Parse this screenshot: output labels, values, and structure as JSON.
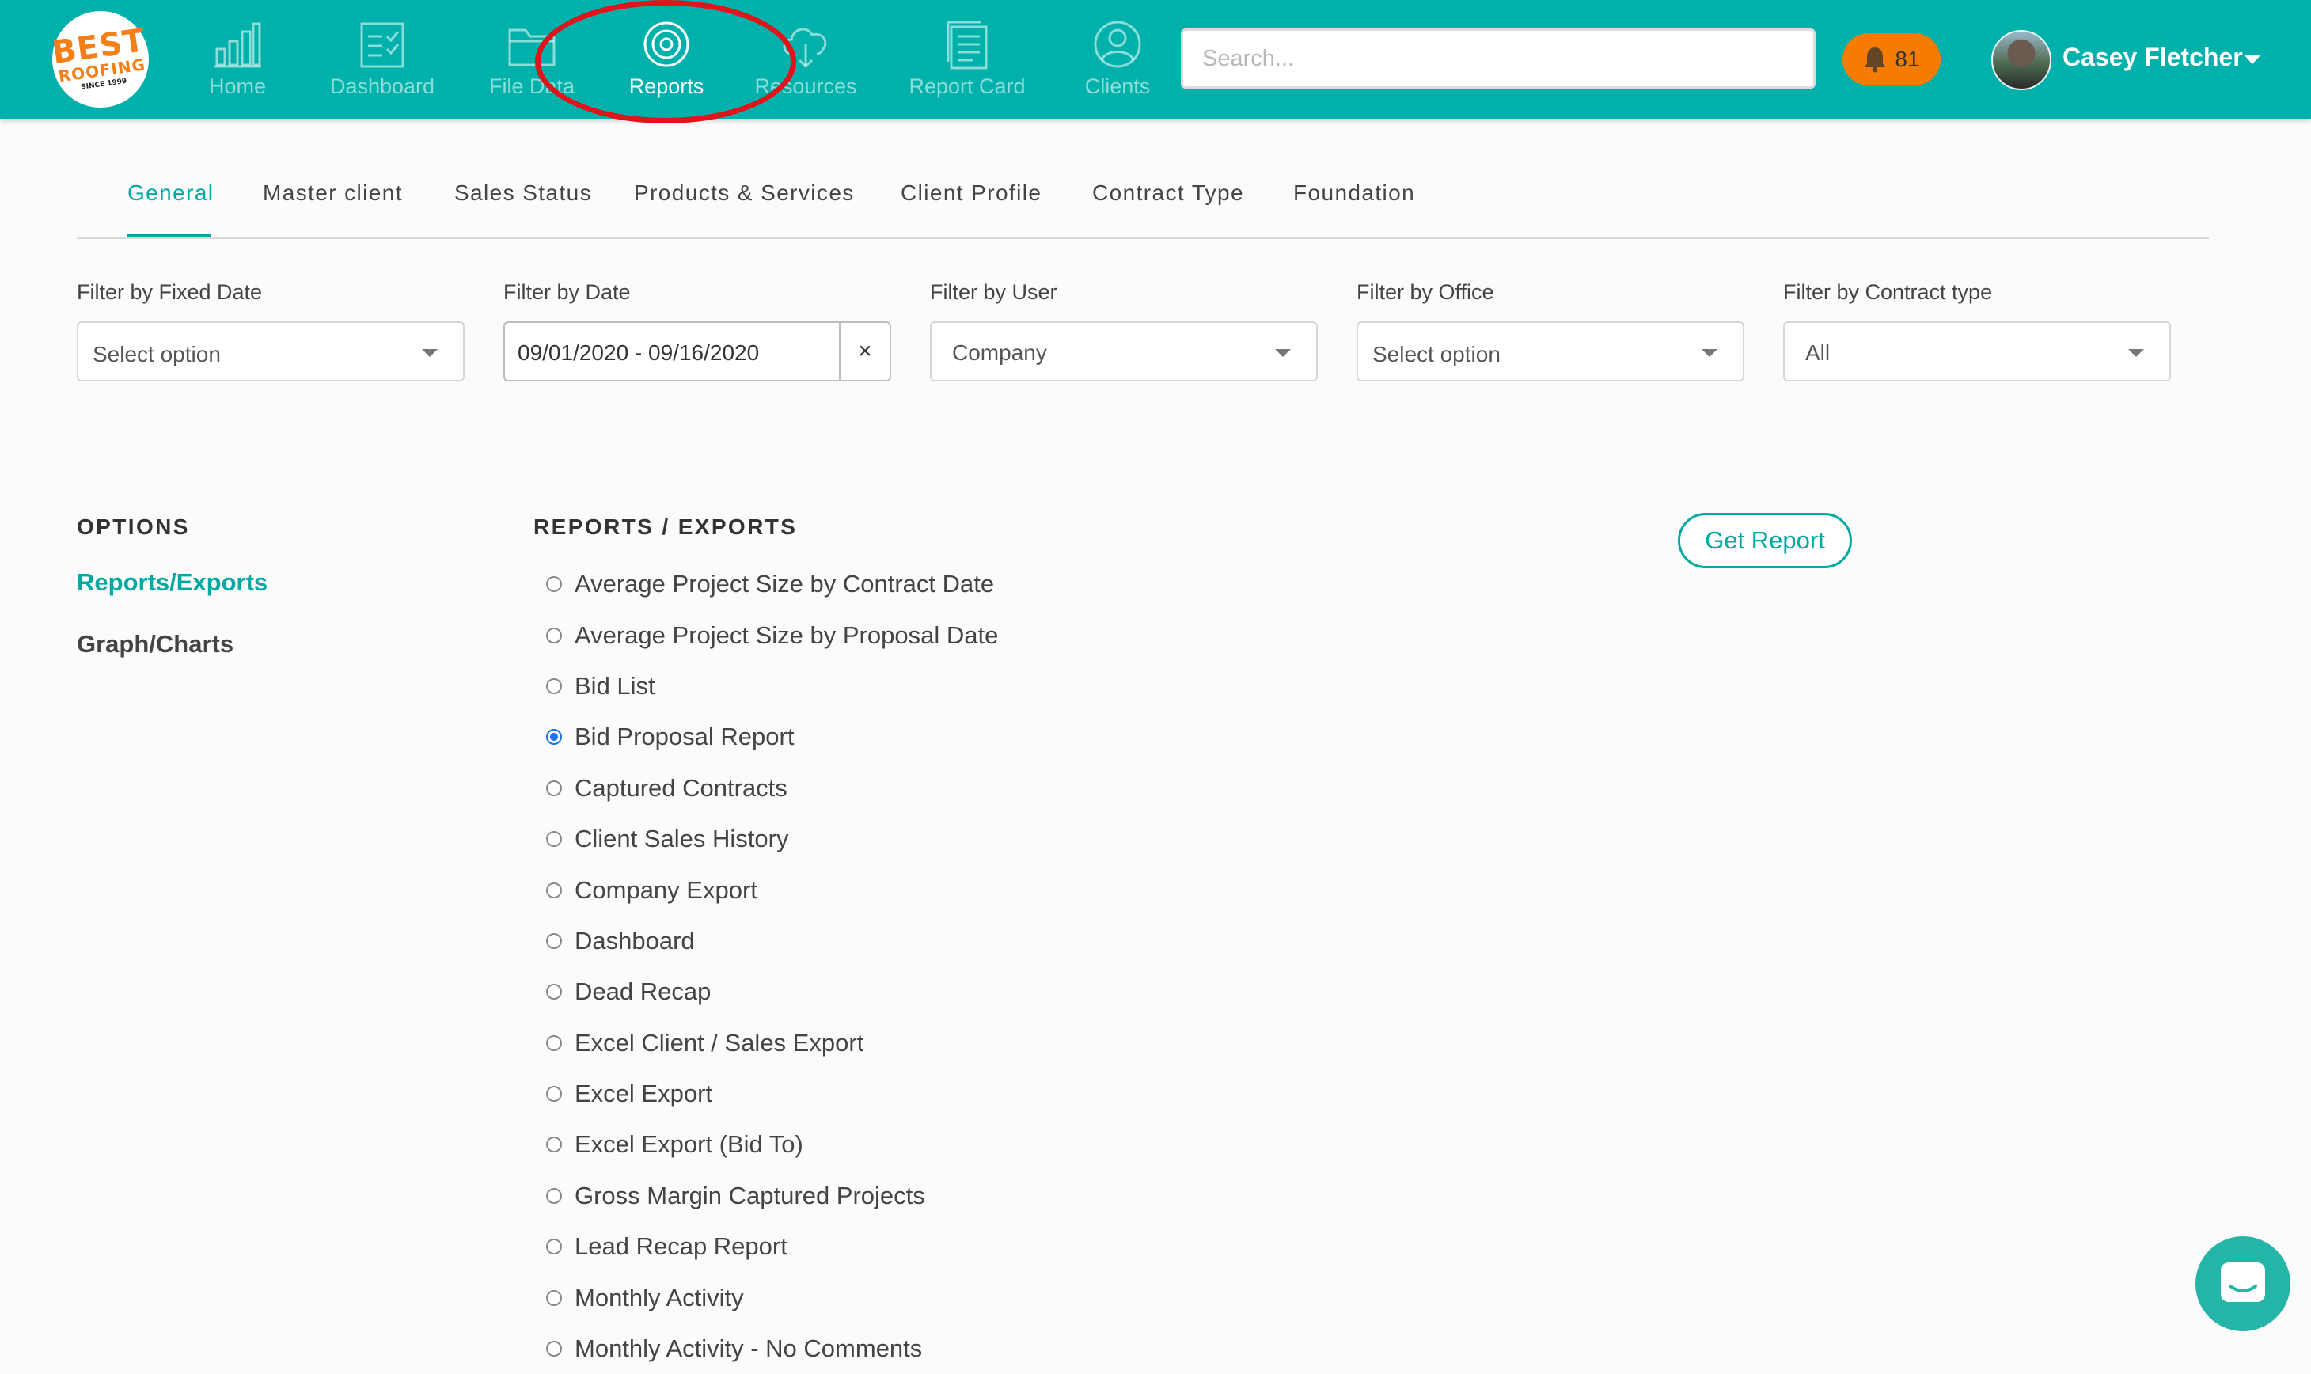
{
  "brand": {
    "logo_text_line1": "BEST",
    "logo_text_line2": "ROOFING",
    "logo_text_line3": "SINCE 1999",
    "accent_color": "#00b1ab",
    "highlight_color": "#e0141b"
  },
  "nav": {
    "items": [
      {
        "label": "Home",
        "icon": "bar-chart-icon",
        "active": false
      },
      {
        "label": "Dashboard",
        "icon": "clipboard-check-icon",
        "active": false
      },
      {
        "label": "File Data",
        "icon": "folder-icon",
        "active": false
      },
      {
        "label": "Reports",
        "icon": "target-icon",
        "active": true
      },
      {
        "label": "Resources",
        "icon": "cloud-download-icon",
        "active": false
      },
      {
        "label": "Report Card",
        "icon": "document-icon",
        "active": false
      },
      {
        "label": "Clients",
        "icon": "user-circle-icon",
        "active": false
      }
    ]
  },
  "search": {
    "placeholder": "Search...",
    "value": ""
  },
  "notifications": {
    "icon": "bell-icon",
    "count": "81"
  },
  "user": {
    "name": "Casey Fletcher"
  },
  "tabs": [
    {
      "label": "General",
      "active": true
    },
    {
      "label": "Master client",
      "active": false
    },
    {
      "label": "Sales Status",
      "active": false
    },
    {
      "label": "Products & Services",
      "active": false
    },
    {
      "label": "Client Profile",
      "active": false
    },
    {
      "label": "Contract Type",
      "active": false
    },
    {
      "label": "Foundation",
      "active": false
    }
  ],
  "filters": {
    "fixed_date": {
      "label": "Filter by Fixed Date",
      "value": "Select option"
    },
    "date": {
      "label": "Filter by Date",
      "value": "09/01/2020 - 09/16/2020",
      "clear": "×"
    },
    "user": {
      "label": "Filter by User",
      "value": "Company"
    },
    "office": {
      "label": "Filter by Office",
      "value": "Select option"
    },
    "contract_type": {
      "label": "Filter by Contract type",
      "value": "All"
    }
  },
  "options": {
    "heading": "OPTIONS",
    "links": [
      {
        "label": "Reports/Exports",
        "active": true
      },
      {
        "label": "Graph/Charts",
        "active": false
      }
    ]
  },
  "reports": {
    "heading": "REPORTS / EXPORTS",
    "get_report_label": "Get Report",
    "items": [
      {
        "label": "Average Project Size by Contract Date",
        "checked": false
      },
      {
        "label": "Average Project Size by Proposal Date",
        "checked": false
      },
      {
        "label": "Bid List",
        "checked": false
      },
      {
        "label": "Bid Proposal Report",
        "checked": true
      },
      {
        "label": "Captured Contracts",
        "checked": false
      },
      {
        "label": "Client Sales History",
        "checked": false
      },
      {
        "label": "Company Export",
        "checked": false
      },
      {
        "label": "Dashboard",
        "checked": false
      },
      {
        "label": "Dead Recap",
        "checked": false
      },
      {
        "label": "Excel Client / Sales Export",
        "checked": false
      },
      {
        "label": "Excel Export",
        "checked": false
      },
      {
        "label": "Excel Export (Bid To)",
        "checked": false
      },
      {
        "label": "Gross Margin Captured Projects",
        "checked": false
      },
      {
        "label": "Lead Recap Report",
        "checked": false
      },
      {
        "label": "Monthly Activity",
        "checked": false
      },
      {
        "label": "Monthly Activity - No Comments",
        "checked": false
      }
    ]
  },
  "chat": {
    "icon": "chat-bubble-icon"
  }
}
